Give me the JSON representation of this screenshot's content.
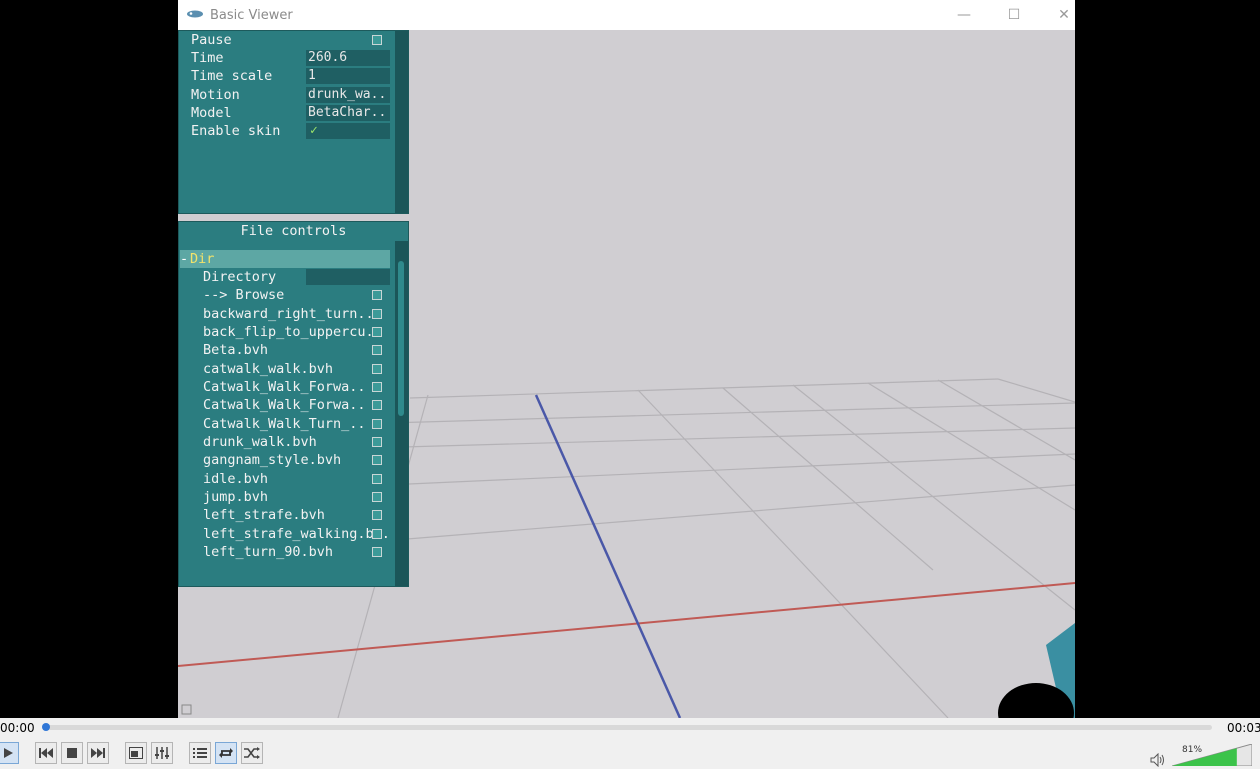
{
  "window": {
    "title": "Basic Viewer",
    "minimize": "—",
    "maximize": "☐",
    "close": "✕"
  },
  "main_panel": {
    "rows": [
      {
        "label": "Pause",
        "type": "checkbox"
      },
      {
        "label": "Time",
        "value": "260.6"
      },
      {
        "label": "Time scale",
        "value": "1"
      },
      {
        "label": "Motion",
        "value": "drunk_wa.."
      },
      {
        "label": "Model",
        "value": "BetaChar.."
      },
      {
        "label": "Enable skin",
        "value": "✓"
      }
    ]
  },
  "file_panel": {
    "title": "File controls",
    "group": "Dir",
    "group_toggle": "-",
    "directory_label": "Directory",
    "browse_label": "--> Browse",
    "files": [
      "backward_right_turn..",
      "back_flip_to_uppercu..",
      "Beta.bvh",
      "catwalk_walk.bvh",
      "Catwalk_Walk_Forwa..",
      "Catwalk_Walk_Forwa..",
      "Catwalk_Walk_Turn_..",
      "drunk_walk.bvh",
      "gangnam_style.bvh",
      "idle.bvh",
      "jump.bvh",
      "left_strafe.bvh",
      "left_strafe_walking.b..",
      "left_turn_90.bvh"
    ]
  },
  "player": {
    "time_elapsed": "00:00",
    "time_total": "00:03",
    "progress": 0.0,
    "volume": "81%",
    "volume_level": 0.81
  },
  "colors": {
    "panel": "#2b7d80",
    "accent": "#2f76d6",
    "volume": "#3cc34a",
    "axis_x": "#c05a55",
    "axis_z": "#4a58a8"
  }
}
